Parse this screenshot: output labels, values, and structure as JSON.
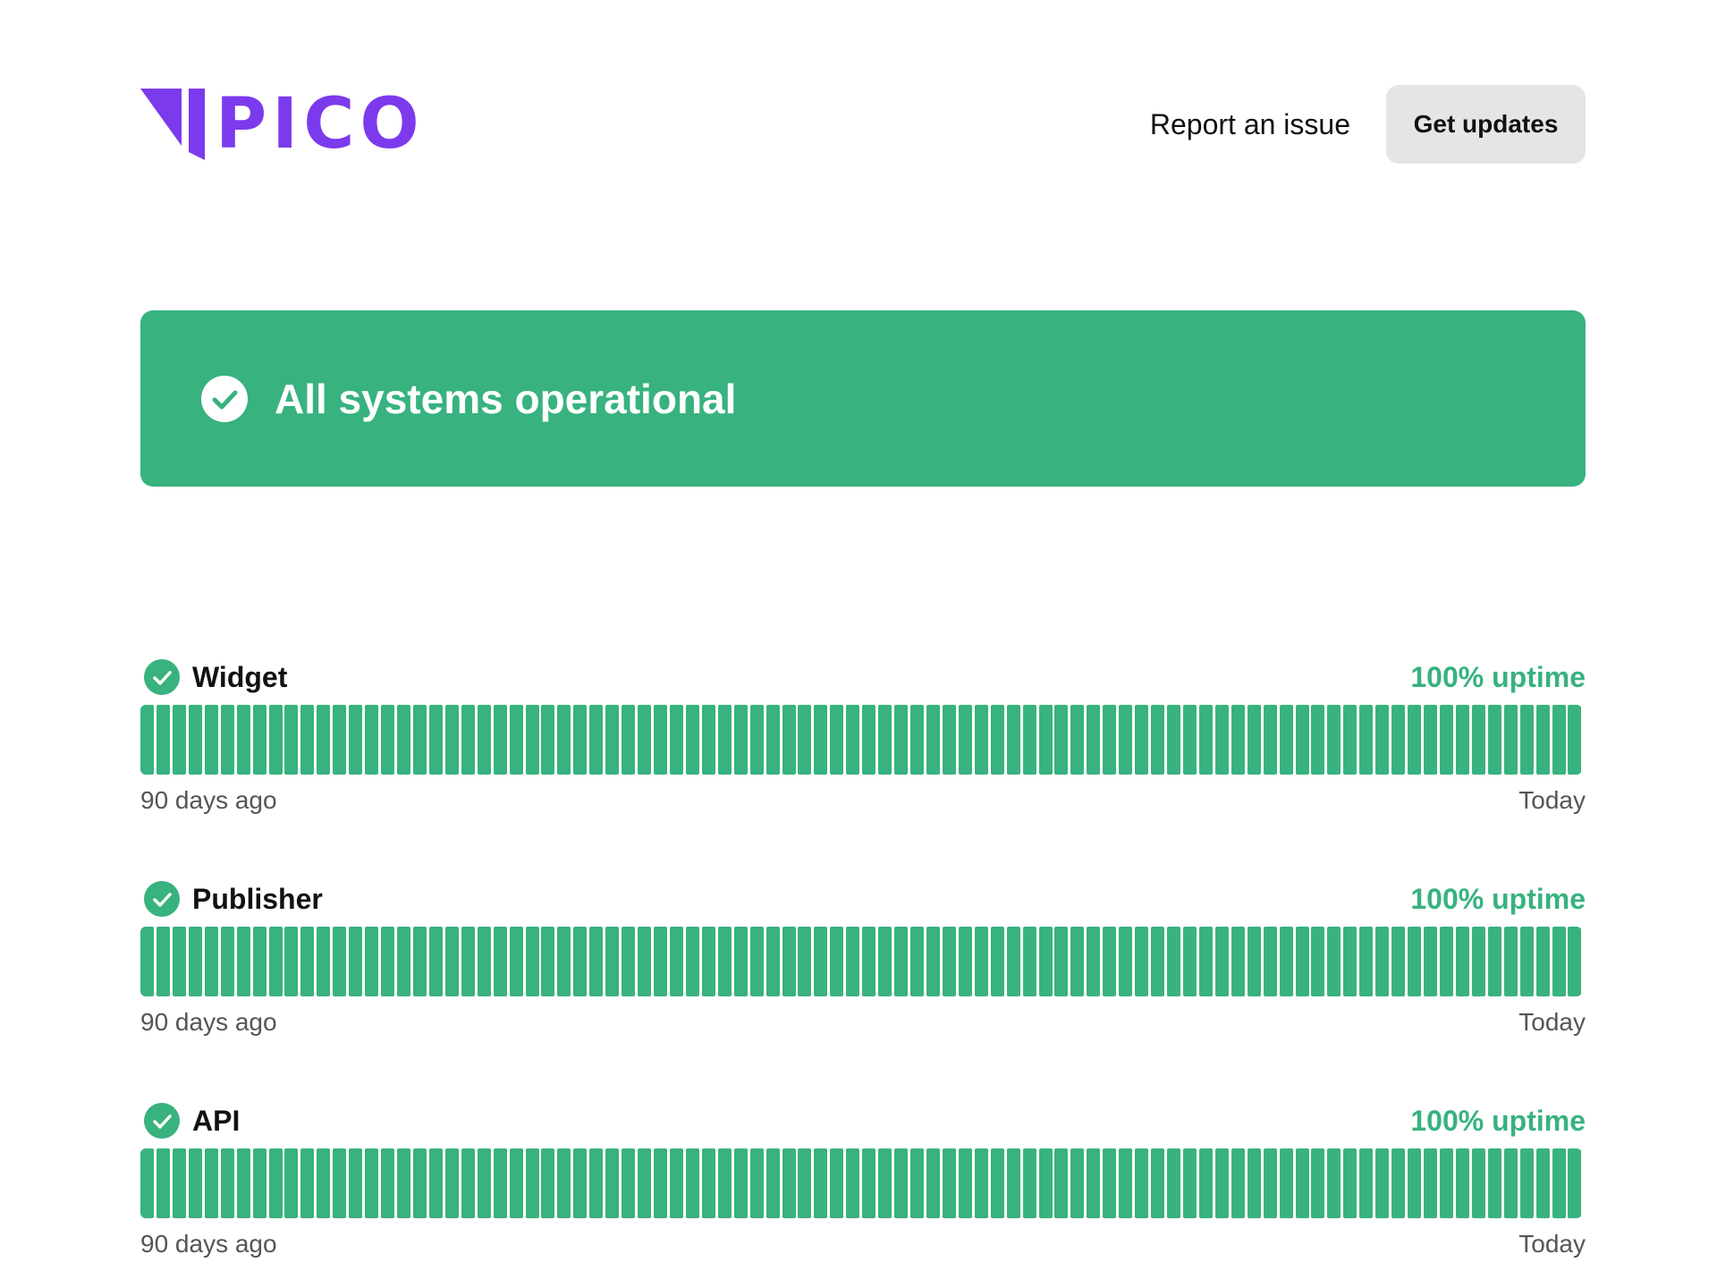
{
  "colors": {
    "brand": "#7c3aed",
    "operational": "#38b27f",
    "button_bg": "#e5e5e5"
  },
  "header": {
    "logo_text": "PICO",
    "logo_icon": "pico-logo-mark",
    "report_link": "Report an issue",
    "updates_button": "Get updates"
  },
  "banner": {
    "icon": "check-circle-icon",
    "text": "All systems operational"
  },
  "components": [
    {
      "name": "Widget",
      "uptime": "100% uptime",
      "start_label": "90 days ago",
      "end_label": "Today",
      "days": 90,
      "days_operational": 90
    },
    {
      "name": "Publisher",
      "uptime": "100% uptime",
      "start_label": "90 days ago",
      "end_label": "Today",
      "days": 90,
      "days_operational": 90
    },
    {
      "name": "API",
      "uptime": "100% uptime",
      "start_label": "90 days ago",
      "end_label": "Today",
      "days": 90,
      "days_operational": 90
    }
  ]
}
